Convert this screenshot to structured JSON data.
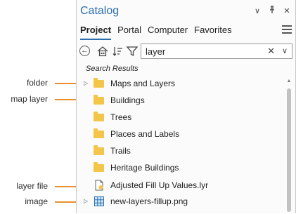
{
  "callouts": {
    "folder": "folder",
    "map_layer": "map layer",
    "layer_file": "layer file",
    "image": "image"
  },
  "panel": {
    "title": "Catalog",
    "title_icons": [
      "chevron-down-icon",
      "pin-icon",
      "close-icon"
    ],
    "tabs": [
      {
        "label": "Project",
        "active": true
      },
      {
        "label": "Portal",
        "active": false
      },
      {
        "label": "Computer",
        "active": false
      },
      {
        "label": "Favorites",
        "active": false
      }
    ],
    "menu_icon": "hamburger-menu-icon",
    "accent_color": "#2c6fb1"
  },
  "toolbar": {
    "icons": [
      "back-icon",
      "home-icon",
      "sort-icon",
      "filter-icon"
    ],
    "search": {
      "value": "layer",
      "clear_icon": "close-icon",
      "dropdown_icon": "chevron-down-icon"
    }
  },
  "results": {
    "header": "Search Results",
    "items": [
      {
        "label": "Maps and Layers",
        "type": "folder",
        "expandable": true,
        "icon": "folder-icon"
      },
      {
        "label": "Buildings",
        "type": "map layer",
        "expandable": false,
        "icon": "folder-icon"
      },
      {
        "label": "Trees",
        "type": "map layer",
        "expandable": false,
        "icon": "folder-icon"
      },
      {
        "label": "Places and Labels",
        "type": "map layer",
        "expandable": false,
        "icon": "folder-icon"
      },
      {
        "label": "Trails",
        "type": "map layer",
        "expandable": false,
        "icon": "folder-icon"
      },
      {
        "label": "Heritage Buildings",
        "type": "map layer",
        "expandable": false,
        "icon": "folder-icon"
      },
      {
        "label": "Adjusted Fill Up Values.lyr",
        "type": "layer file",
        "expandable": false,
        "icon": "layer-file-icon"
      },
      {
        "label": "new-layers-fillup.png",
        "type": "image",
        "expandable": true,
        "icon": "image-icon"
      }
    ]
  },
  "colors": {
    "folder": "#f3c64a",
    "callout_line": "#e8902f"
  }
}
